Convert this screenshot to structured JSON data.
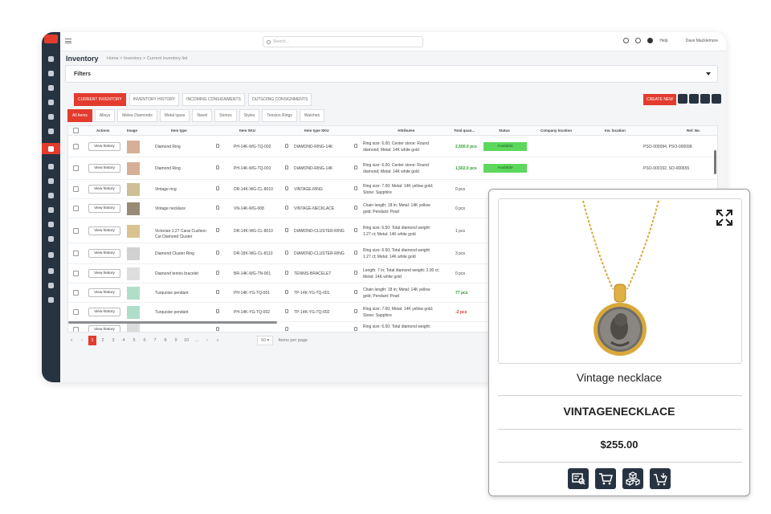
{
  "topbar": {
    "search_placeholder": "Search...",
    "help": "Help",
    "user": "Dave Macklemore"
  },
  "page": {
    "title": "Inventory",
    "breadcrumb": "Home > Inventory > Current inventory list",
    "filters_label": "Filters"
  },
  "tabs": [
    "Current inventory",
    "Inventory history",
    "Incoming consignments",
    "Outgoing consignments"
  ],
  "create_new": "Create new",
  "subtabs": [
    "All items",
    "Alloys",
    "Melee Diamonds",
    "Metal types",
    "Navel",
    "Stones",
    "Styles",
    "Tension Rings",
    "Watches"
  ],
  "table": {
    "headers": [
      "Actions",
      "Image",
      "Item type",
      "Item SKU",
      "Item type SKU",
      "Attributes",
      "Total quan...",
      "Status",
      "Company location",
      "Inv. location",
      "Ref. No."
    ],
    "view_history": "View history",
    "rows": [
      {
        "item_type": "Diamond Ring",
        "sku": "PH-14K-WG-TQ-002",
        "type_sku": "DIAMOND-RING-14K",
        "attr1": "Ring size: 6.00; Center stone: Round",
        "attr2": "diamond; Metal: 14K white gold",
        "qty": "2,500.0 pcs",
        "status": "Available",
        "ref": "PSO-000094, PSO-000098"
      },
      {
        "item_type": "Diamond Ring",
        "sku": "PH-14K-WG-TQ-001",
        "type_sku": "DIAMOND-RING-14K",
        "attr1": "Ring size: 6.00; Center stone: Round",
        "attr2": "diamond; Metal: 14K white gold",
        "qty": "1,502.0 pcs",
        "status": "Available",
        "ref": "PSO-000192, SO-000655"
      },
      {
        "item_type": "Vintage ring",
        "sku": "DR-14K-WG-CL-8010",
        "type_sku": "VINTAGE-RING",
        "attr1": "Ring size: 7.00; Metal: 14K yellow gold;",
        "attr2": "Stone: Sapphire",
        "qty": "0 pcs",
        "status": "",
        "ref": ""
      },
      {
        "item_type": "Vintage necklace",
        "sku": "VN-14K-WG-008",
        "type_sku": "VINTAGE-NECKLACE",
        "attr1": "Chain length: 18 in; Metal: 14K yellow",
        "attr2": "gold; Pendant: Pearl",
        "qty": "0 pcs",
        "status": "",
        "ref": ""
      },
      {
        "item_type": "Victorian 1.27 Carat Cushion Cut Diamond Cluster",
        "sku": "DR-14K-WG-CL-8010",
        "type_sku": "DIAMOND-CLUSTER-RING",
        "attr1": "Ring size: 6.50; Total diamond weight:",
        "attr2": "1.27 ct; Metal: 14K white gold",
        "qty": "1 pcs",
        "status": "",
        "ref": ""
      },
      {
        "item_type": "Diamond Cluster Ring",
        "sku": "DR-18K-WG-CL-8110",
        "type_sku": "DIAMOND-CLUSTER-RING",
        "attr1": "Ring size: 6.50; Total diamond weight:",
        "attr2": "1.27 ct; Metal: 14K white gold",
        "qty": "3 pcs",
        "status": "",
        "ref": ""
      },
      {
        "item_type": "Diamond tennis bracelet",
        "sku": "BR-14K-WG-TN-001",
        "type_sku": "TENNIS-BRACELET",
        "attr1": "Length: 7 in; Total diamond weight: 2.00 ct;",
        "attr2": "Metal: 14K white gold",
        "qty": "0 pcs",
        "status": "",
        "ref": ""
      },
      {
        "item_type": "Turquoise pendant",
        "sku": "PH-14K-YG-TQ-001",
        "type_sku": "TP-14K-YG-TQ-001",
        "attr1": "Chain length: 18 in; Metal: 14K yellow",
        "attr2": "gold; Pendant: Pearl",
        "qty": "77 pcs",
        "status": "",
        "ref": ""
      },
      {
        "item_type": "Turquoise pendant",
        "sku": "PH-14K-YG-TQ-002",
        "type_sku": "TP-14K-YG-TQ-002",
        "attr1": "Ring size: 7.00; Metal: 14K yellow gold;",
        "attr2": "Stone: Sapphire",
        "qty": "-2 pcs",
        "status": "",
        "ref": ""
      },
      {
        "item_type": "",
        "sku": "",
        "type_sku": "",
        "attr1": "Ring size: 6.50; Total diamond weight:",
        "attr2": "",
        "qty": "",
        "status": "",
        "ref": ""
      }
    ]
  },
  "pager": {
    "pages": [
      "1",
      "2",
      "3",
      "4",
      "5",
      "6",
      "7",
      "8",
      "9",
      "10",
      "..."
    ],
    "per_page_value": "50",
    "per_page_label": "Items per page"
  },
  "card": {
    "name": "Vintage necklace",
    "sku": "VINTAGENECKLACE",
    "price": "$255.00"
  },
  "colors": {
    "accent": "#e33b2e",
    "sidebar": "#283342",
    "available": "#5dd85d"
  }
}
